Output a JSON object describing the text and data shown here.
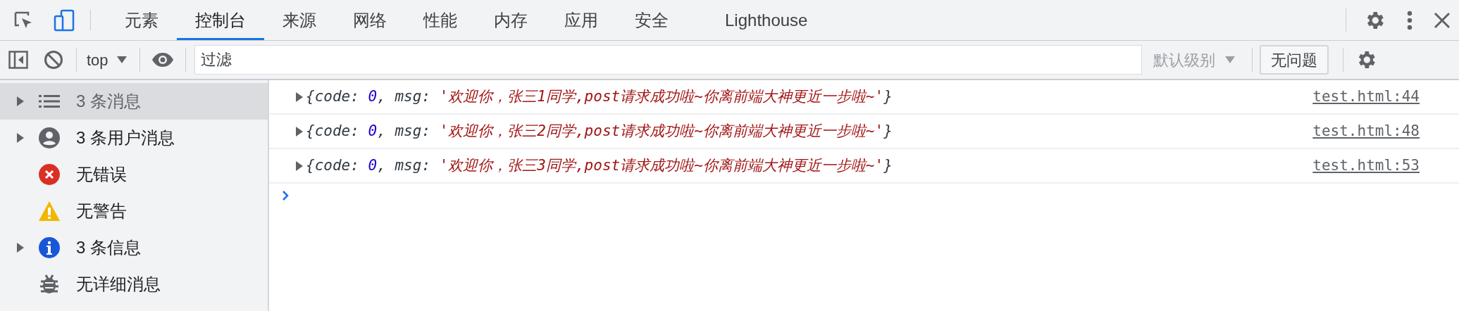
{
  "tabs": [
    {
      "label": "元素",
      "selected": false
    },
    {
      "label": "控制台",
      "selected": true
    },
    {
      "label": "来源",
      "selected": false
    },
    {
      "label": "网络",
      "selected": false
    },
    {
      "label": "性能",
      "selected": false
    },
    {
      "label": "内存",
      "selected": false
    },
    {
      "label": "应用",
      "selected": false
    },
    {
      "label": "安全",
      "selected": false
    },
    {
      "label": "Lighthouse",
      "selected": false
    }
  ],
  "toolbar": {
    "context": "top",
    "filter": {
      "placeholder": "过滤"
    },
    "levels": {
      "label": "默认级别",
      "disabled": true
    },
    "issues_button": "无问题"
  },
  "sidebar": {
    "items": [
      {
        "kind": "messages",
        "label": "3 条消息",
        "selected": true,
        "expandable": true
      },
      {
        "kind": "user",
        "label": "3 条用户消息",
        "selected": false,
        "expandable": true
      },
      {
        "kind": "error",
        "label": "无错误",
        "selected": false,
        "expandable": false
      },
      {
        "kind": "warning",
        "label": "无警告",
        "selected": false,
        "expandable": false
      },
      {
        "kind": "info",
        "label": "3 条信息",
        "selected": false,
        "expandable": true
      },
      {
        "kind": "verbose",
        "label": "无详细消息",
        "selected": false,
        "expandable": false
      }
    ]
  },
  "messages": [
    {
      "expanded": false,
      "parts": [
        {
          "kind": "punct",
          "text": "{code: "
        },
        {
          "kind": "number",
          "text": "0"
        },
        {
          "kind": "punct",
          "text": ", msg: "
        },
        {
          "kind": "string",
          "text": "'欢迎你，张三1同学,post请求成功啦~你离前端大神更近一步啦~'"
        },
        {
          "kind": "punct",
          "text": "}"
        }
      ],
      "source": "test.html:44"
    },
    {
      "expanded": false,
      "parts": [
        {
          "kind": "punct",
          "text": "{code: "
        },
        {
          "kind": "number",
          "text": "0"
        },
        {
          "kind": "punct",
          "text": ", msg: "
        },
        {
          "kind": "string",
          "text": "'欢迎你，张三2同学,post请求成功啦~你离前端大神更近一步啦~'"
        },
        {
          "kind": "punct",
          "text": "}"
        }
      ],
      "source": "test.html:48"
    },
    {
      "expanded": false,
      "parts": [
        {
          "kind": "punct",
          "text": "{code: "
        },
        {
          "kind": "number",
          "text": "0"
        },
        {
          "kind": "punct",
          "text": ", msg: "
        },
        {
          "kind": "string",
          "text": "'欢迎你，张三3同学,post请求成功啦~你离前端大神更近一步啦~'"
        },
        {
          "kind": "punct",
          "text": "}"
        }
      ],
      "source": "test.html:53"
    }
  ]
}
